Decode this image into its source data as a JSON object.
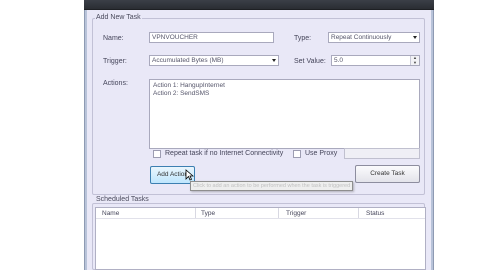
{
  "add_task": {
    "title": "Add New Task",
    "name_label": "Name:",
    "name_value": "VPNVOUCHER",
    "type_label": "Type:",
    "type_value": "Repeat Continuously",
    "trigger_label": "Trigger:",
    "trigger_value": "Accumulated Bytes (MB)",
    "set_value_label": "Set Value:",
    "set_value": "5.0",
    "actions_label": "Actions:",
    "actions": [
      "Action 1: HangupInternet",
      "Action 2: SendSMS"
    ],
    "repeat_label": "Repeat task if no Internet Connectivity",
    "use_proxy_label": "Use Proxy",
    "add_action_button": "Add Action",
    "create_task_button": "Create Task",
    "tooltip": "Click to add an action to be performed when the task is triggered"
  },
  "scheduled": {
    "title": "Scheduled Tasks",
    "columns": [
      "Name",
      "Type",
      "Trigger",
      "Status"
    ]
  },
  "colors": {
    "panel": "#e9e8f7",
    "button_hot": "#bee6fd"
  }
}
